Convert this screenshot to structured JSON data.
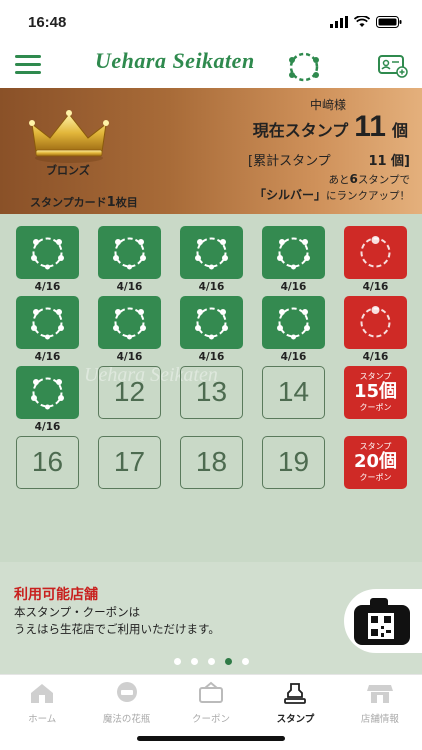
{
  "status_bar": {
    "time": "16:48"
  },
  "header": {
    "logo_text": "Uehara Seikaten"
  },
  "member": {
    "user": "中﨑様",
    "rank": "ブロンズ",
    "card_prefix": "スタンプカード",
    "card_number": "1",
    "card_suffix": "枚目",
    "current_label": "現在スタンプ",
    "current_count": "11",
    "current_unit": "個",
    "total_label": "[累計スタンプ",
    "total_value": "11 個]",
    "next_prefix": "あと",
    "next_count": "6",
    "next_mid": "スタンプで",
    "next_rank": "「シルバー」",
    "next_suffix": "にランクアップ！"
  },
  "stamps": {
    "dates": [
      "4/16",
      "4/16",
      "4/16",
      "4/16",
      "4/16",
      "4/16",
      "4/16",
      "4/16",
      "4/16",
      "4/16",
      "4/16"
    ],
    "empty": [
      "12",
      "13",
      "14",
      "16",
      "17",
      "18",
      "19"
    ],
    "coupons": [
      {
        "top": "スタンプ",
        "value": "15個",
        "bottom": "クーポン"
      },
      {
        "top": "スタンプ",
        "value": "20個",
        "bottom": "クーポン"
      }
    ],
    "coupon_dates": [
      "4/16",
      "4/16"
    ],
    "watermark": "Uehara Seikaten"
  },
  "stores": {
    "title": "利用可能店舗",
    "line1": "本スタンプ・クーポンは",
    "line2": "うえはら生花店でご利用いただけます。"
  },
  "pager": {
    "count": 5,
    "active": 3
  },
  "tabs": [
    {
      "label": "ホーム",
      "icon": "house-icon"
    },
    {
      "label": "魔法の花瓶",
      "icon": "vase-icon"
    },
    {
      "label": "クーポン",
      "icon": "coupon-icon"
    },
    {
      "label": "スタンプ",
      "icon": "stamp-icon",
      "active": true
    },
    {
      "label": "店舗情報",
      "icon": "store-icon"
    }
  ],
  "colors": {
    "green": "#348a50",
    "red": "#cf2a26",
    "bronze": "#a86b38",
    "background": "#c9d9c7"
  }
}
